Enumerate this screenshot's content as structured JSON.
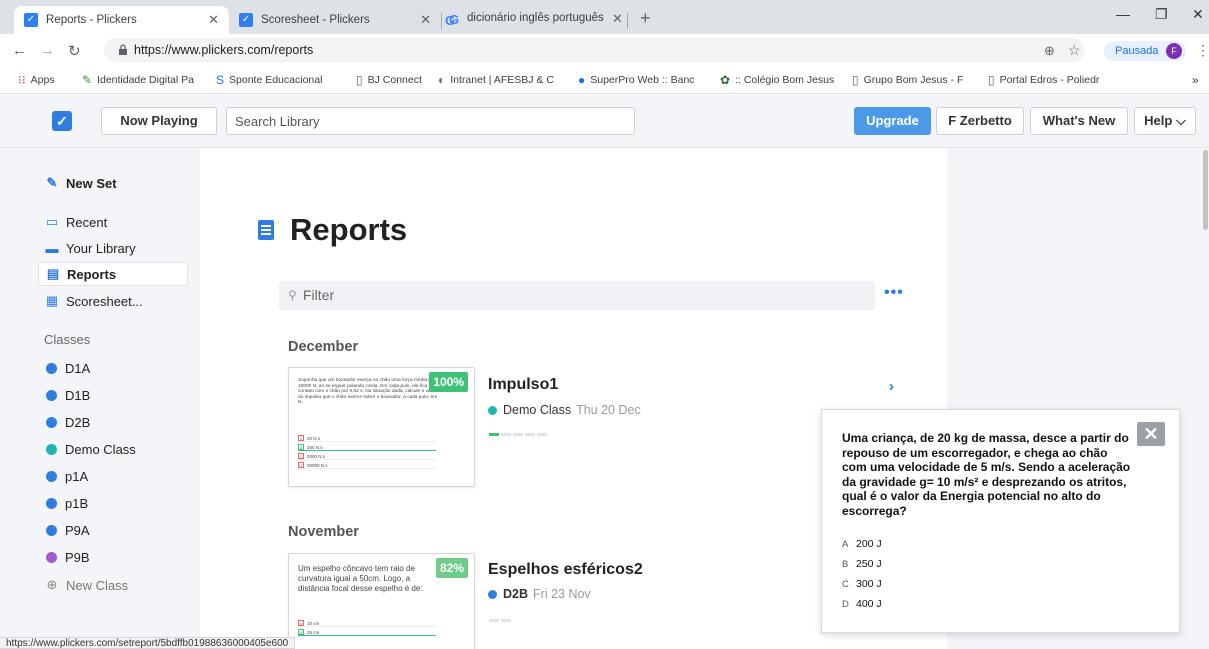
{
  "browser": {
    "tabs": [
      {
        "title": "Reports - Plickers",
        "close": "✕"
      },
      {
        "title": "Scoresheet - Plickers",
        "close": "✕"
      },
      {
        "title": "dicionário inglês português - Pes",
        "close": "✕"
      }
    ],
    "new_tab": "+",
    "window_controls": [
      "—",
      "❐",
      "✕"
    ],
    "url": "https://www.plickers.com/reports",
    "profile_label": "Pausada",
    "profile_initial": "F",
    "bookmarks": [
      {
        "label": "Apps",
        "icon": "apps-grid-icon"
      },
      {
        "label": "Identidade Digital Pa",
        "icon": "leaf-icon"
      },
      {
        "label": "Sponte Educacional",
        "icon": "sponte-icon"
      },
      {
        "label": "BJ Connect",
        "icon": "page-icon"
      },
      {
        "label": "Intranet | AFESBJ & C",
        "icon": "intranet-icon"
      },
      {
        "label": "SuperPro Web :: Banc",
        "icon": "superpro-icon"
      },
      {
        "label": ":: Colégio Bom Jesus",
        "icon": "bomjesus-icon"
      },
      {
        "label": "Grupo Bom Jesus - F",
        "icon": "page-icon"
      },
      {
        "label": "Portal Edros - Poliedr",
        "icon": "page-icon"
      }
    ],
    "bookmarks_more": "»",
    "status_url": "https://www.plickers.com/setreport/5bdffb019886360004​05e600"
  },
  "topnav": {
    "now_playing": "Now Playing",
    "search_placeholder": "Search Library",
    "upgrade": "Upgrade",
    "user": "F Zerbetto",
    "whats_new": "What's New",
    "help": "Help ⌵"
  },
  "sidebar": {
    "new_set": "New Set",
    "nav": [
      "Recent",
      "Your Library",
      "Reports",
      "Scoresheet..."
    ],
    "classes_heading": "Classes",
    "classes": [
      {
        "name": "D1A",
        "color": "#2f7de1"
      },
      {
        "name": "D1B",
        "color": "#2f7de1"
      },
      {
        "name": "D2B",
        "color": "#2f7de1"
      },
      {
        "name": "Demo Class",
        "color": "#1fb5b0"
      },
      {
        "name": "p1A",
        "color": "#2f7de1"
      },
      {
        "name": "p1B",
        "color": "#2f7de1"
      },
      {
        "name": "P9A",
        "color": "#2f7de1"
      },
      {
        "name": "P9B",
        "color": "#a05ad0"
      }
    ],
    "new_class": "New Class"
  },
  "main": {
    "title": "Reports",
    "filter_placeholder": "Filter",
    "more": "•••",
    "groups": [
      {
        "month": "December",
        "set_title": "Impulso1",
        "class_name": "Demo Class",
        "class_color": "#1fb5b0",
        "date": "Thu 20 Dec",
        "score": "100%",
        "question": "Suponha que um boxeador exerça no chão uma força média de 10000 N, ao se erguer pulando corda. Em cada pulo, ele fica em contato com o chão por 0,02 s. Na situação dada, calcule o valor do impulso que o chão exerce sobre o boxeador, a cada pulo, em N.",
        "answers": [
          {
            "letter": "A",
            "text": "20 N.s"
          },
          {
            "letter": "B",
            "text": "200 N.s"
          },
          {
            "letter": "C",
            "text": "2000 N.s"
          },
          {
            "letter": "D",
            "text": "20000 N.s"
          }
        ]
      },
      {
        "month": "November",
        "set_title": "Espelhos esféricos2",
        "class_name": "D2B",
        "class_color": "#2f7de1",
        "date": "Fri 23 Nov",
        "score": "82%",
        "question": "Um espelho côncavo tem raio de curvatura igual a 50cm. Logo, a distância focal desse espelho é de:",
        "answers": [
          {
            "letter": "A",
            "text": "10 cm"
          },
          {
            "letter": "B",
            "text": "25 cm"
          }
        ]
      }
    ]
  },
  "popup": {
    "question": "Uma criança, de 20 kg de massa, desce a partir do repouso de um escorregador, e chega ao chão com uma velocidade de 5 m/s. Sendo a aceleração da gravidade g= 10 m/s² e desprezando os atritos, qual é o valor da Energia potencial no alto do escorrega?",
    "close": "✕",
    "options": [
      {
        "letter": "A",
        "text": "200 J"
      },
      {
        "letter": "B",
        "text": "250 J"
      },
      {
        "letter": "C",
        "text": "300 J"
      },
      {
        "letter": "D",
        "text": "400 J"
      }
    ]
  }
}
